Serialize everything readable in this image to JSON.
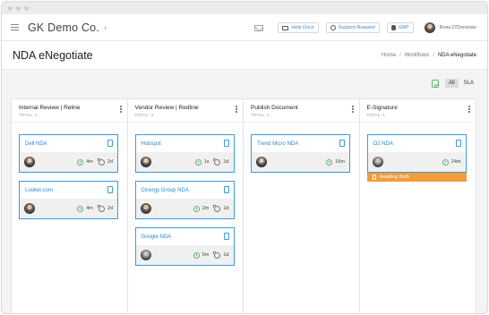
{
  "app": {
    "company": "GK Demo Co.",
    "chevron": "›"
  },
  "header": {
    "help_label": "Help Docs",
    "support_label": "Support Request",
    "currency_label": "GBP",
    "user_name": "Ross O'Donovan"
  },
  "page": {
    "title": "NDA eNegotiate",
    "breadcrumb": [
      "Home",
      "Workflows",
      "NDA eNegotiate"
    ],
    "breadcrumb_sep": "/"
  },
  "filter": {
    "all_label": "All",
    "sla_label": "SLA",
    "active": "All"
  },
  "colors": {
    "accent": "#3a9ae0",
    "status_orange": "#f39c3b",
    "ok_green": "#5fb36a"
  },
  "columns": [
    {
      "title": "Internal Review | Reline",
      "total": "TOTAL: 2",
      "cards": [
        {
          "name": "Dell NDA",
          "time": "4m",
          "days": "2d"
        },
        {
          "name": "Looker.com",
          "time": "4m",
          "days": "2d"
        }
      ]
    },
    {
      "title": "Vendor Review | Redline",
      "total": "TOTAL: 3",
      "cards": [
        {
          "name": "Hubspot",
          "time": "1s",
          "days": "1d"
        },
        {
          "name": "Cinergy Group NDA",
          "time": "2m",
          "days": "1d"
        },
        {
          "name": "Google NDA",
          "time": "5m",
          "days": "1d"
        }
      ]
    },
    {
      "title": "Publish Document",
      "total": "TOTAL: 1",
      "cards": [
        {
          "name": "Trend Micro NDA",
          "time": "16m",
          "days": ""
        }
      ]
    },
    {
      "title": "E-Signature",
      "total": "TOTAL: 1",
      "cards": [
        {
          "name": "O2 NDA",
          "time": "24m",
          "days": "",
          "status": "Awaiting Both"
        }
      ]
    }
  ]
}
